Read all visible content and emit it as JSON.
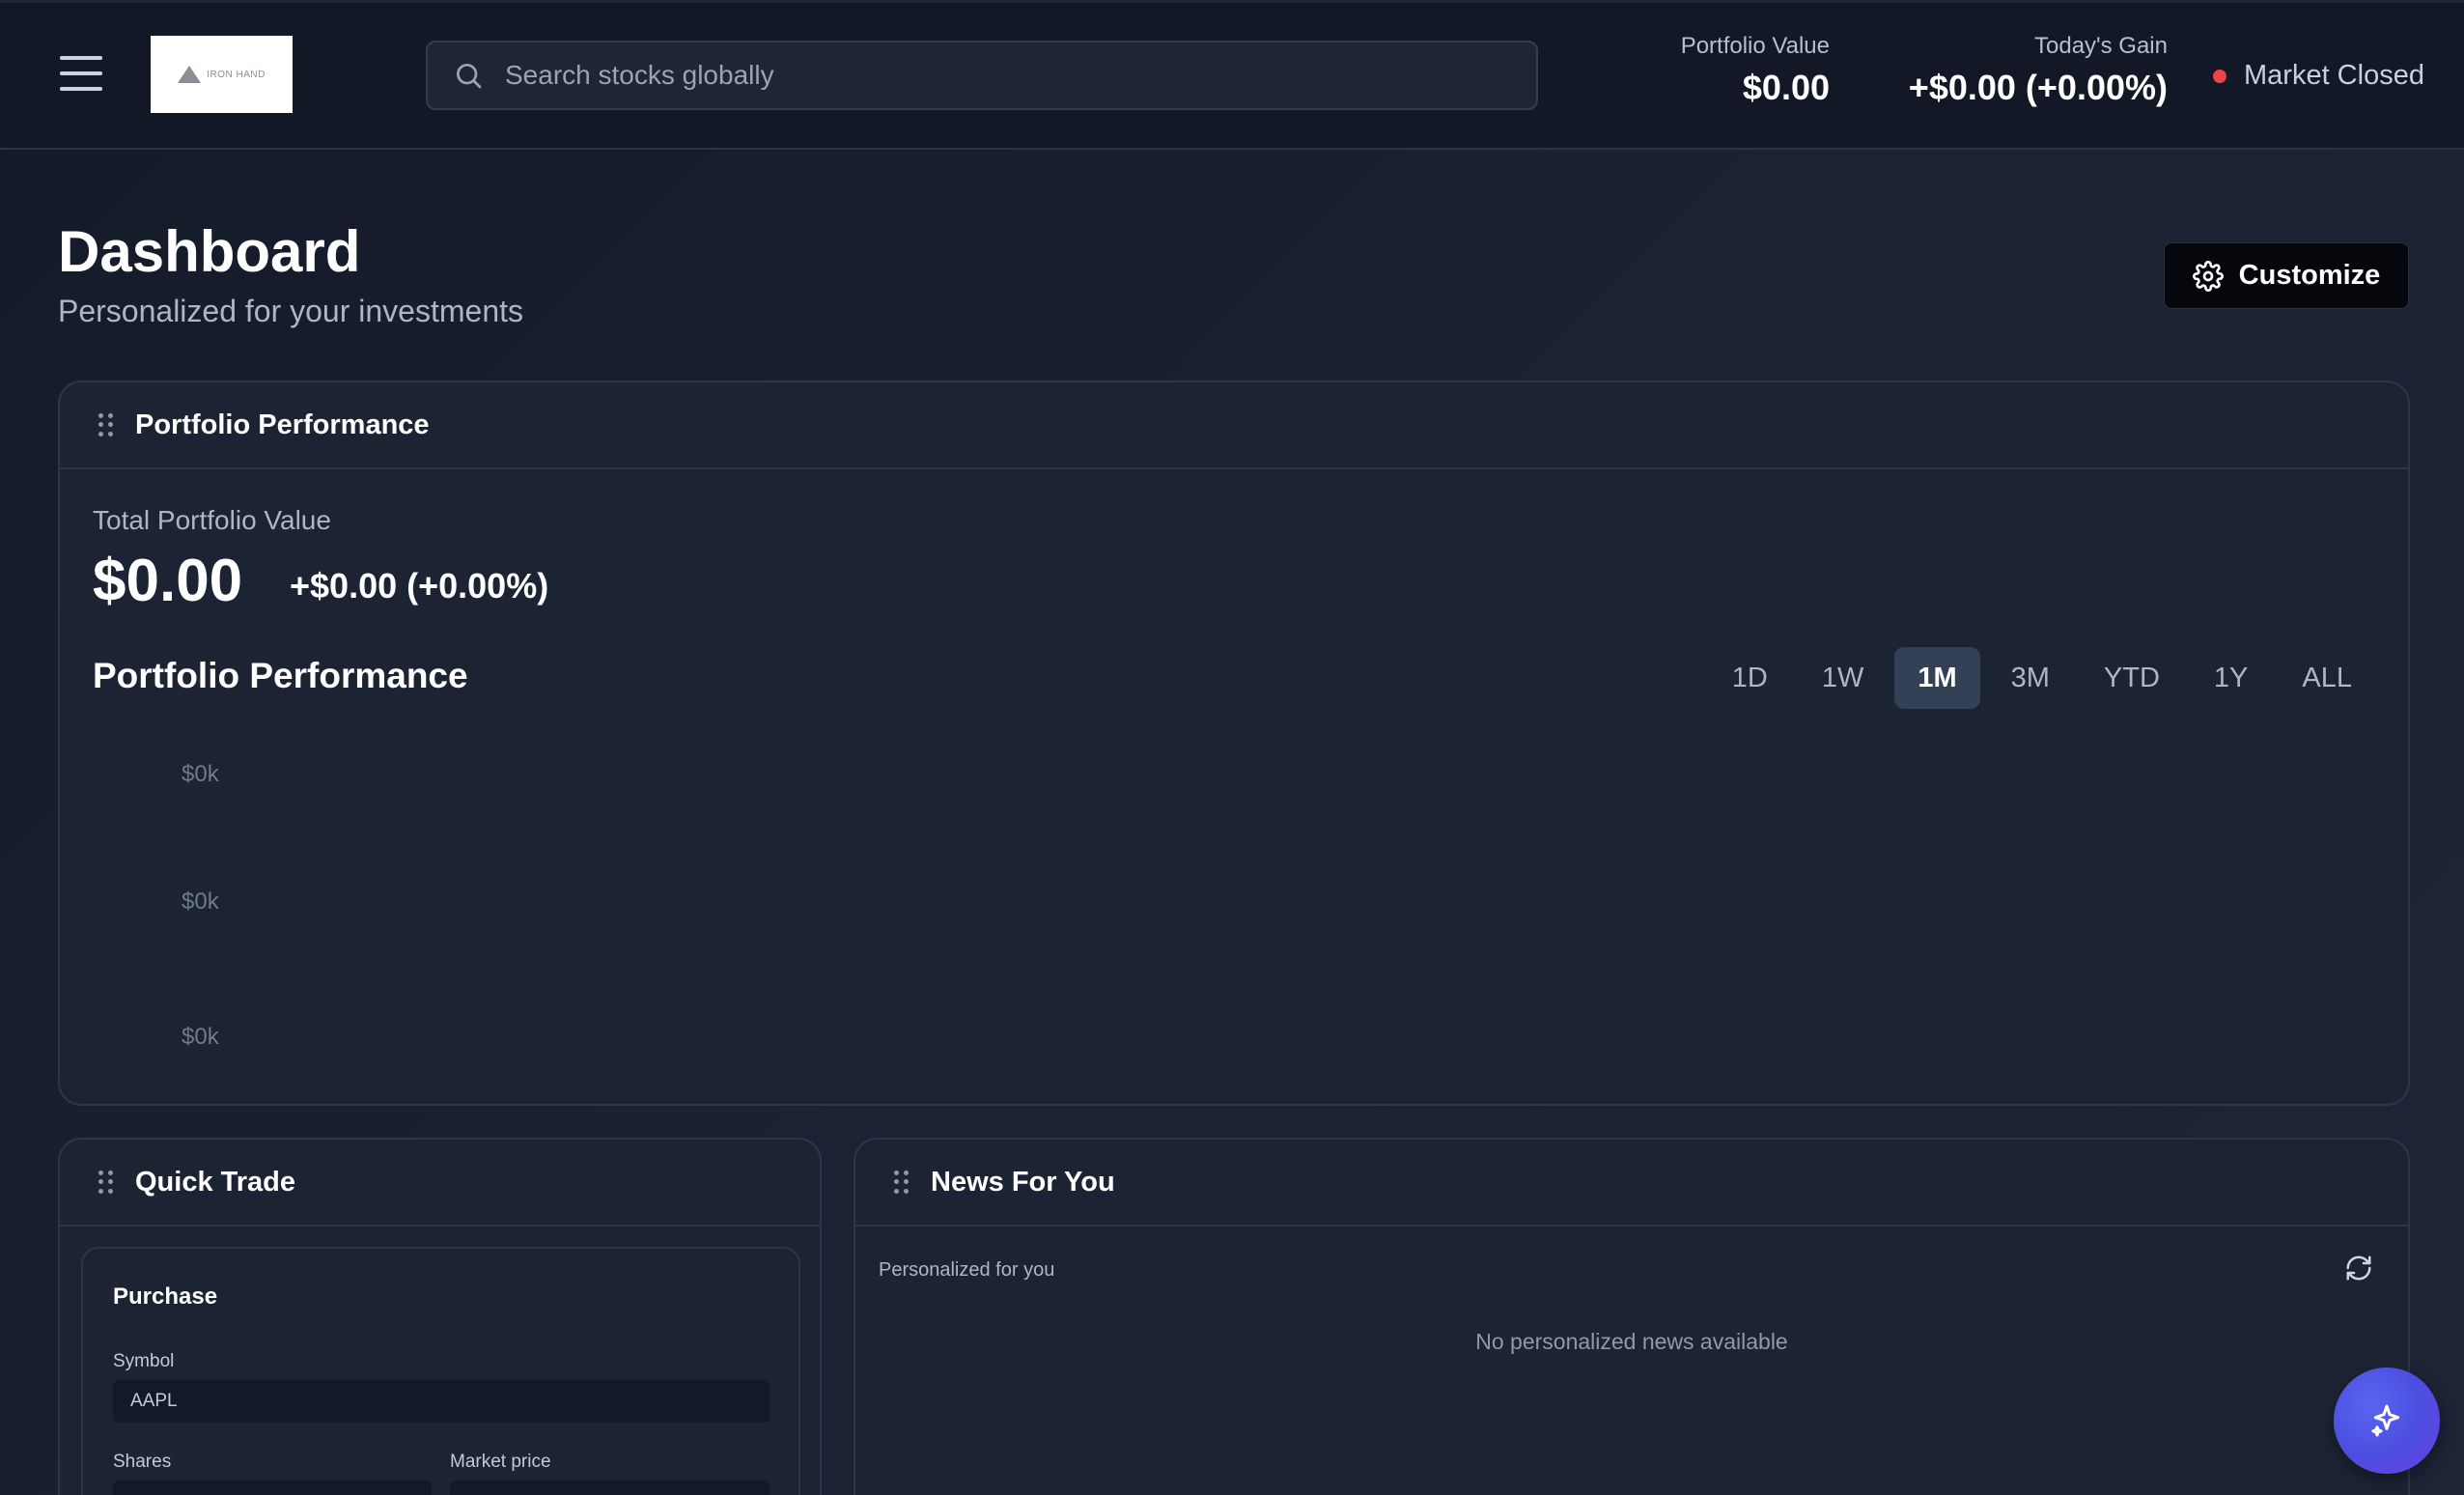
{
  "header": {
    "logo_text": "IRON HAND",
    "search_placeholder": "Search stocks globally",
    "portfolio_value_label": "Portfolio Value",
    "portfolio_value": "$0.00",
    "todays_gain_label": "Today's Gain",
    "todays_gain": "+$0.00 (+0.00%)",
    "market_status": "Market Closed",
    "market_status_color": "#ef4444"
  },
  "page": {
    "title": "Dashboard",
    "subtitle": "Personalized for your investments",
    "customize_label": "Customize"
  },
  "portfolio_card": {
    "title": "Portfolio Performance",
    "total_label": "Total Portfolio Value",
    "total_value": "$0.00",
    "change": "+$0.00 (+0.00%)",
    "chart_title": "Portfolio Performance",
    "ranges": [
      {
        "label": "1D",
        "active": false
      },
      {
        "label": "1W",
        "active": false
      },
      {
        "label": "1M",
        "active": true
      },
      {
        "label": "3M",
        "active": false
      },
      {
        "label": "YTD",
        "active": false
      },
      {
        "label": "1Y",
        "active": false
      },
      {
        "label": "ALL",
        "active": false
      }
    ],
    "y_ticks": [
      "$0k",
      "$0k",
      "$0k"
    ]
  },
  "quick_trade": {
    "title": "Quick Trade",
    "section": "Purchase",
    "symbol_label": "Symbol",
    "symbol_value": "AAPL",
    "shares_label": "Shares",
    "market_price_label": "Market price"
  },
  "news": {
    "title": "News For You",
    "subtitle": "Personalized for you",
    "empty_message": "No personalized news available"
  },
  "colors": {
    "accent": "#4b4fe0",
    "background": "#161d2c",
    "card": "#1c2434"
  }
}
